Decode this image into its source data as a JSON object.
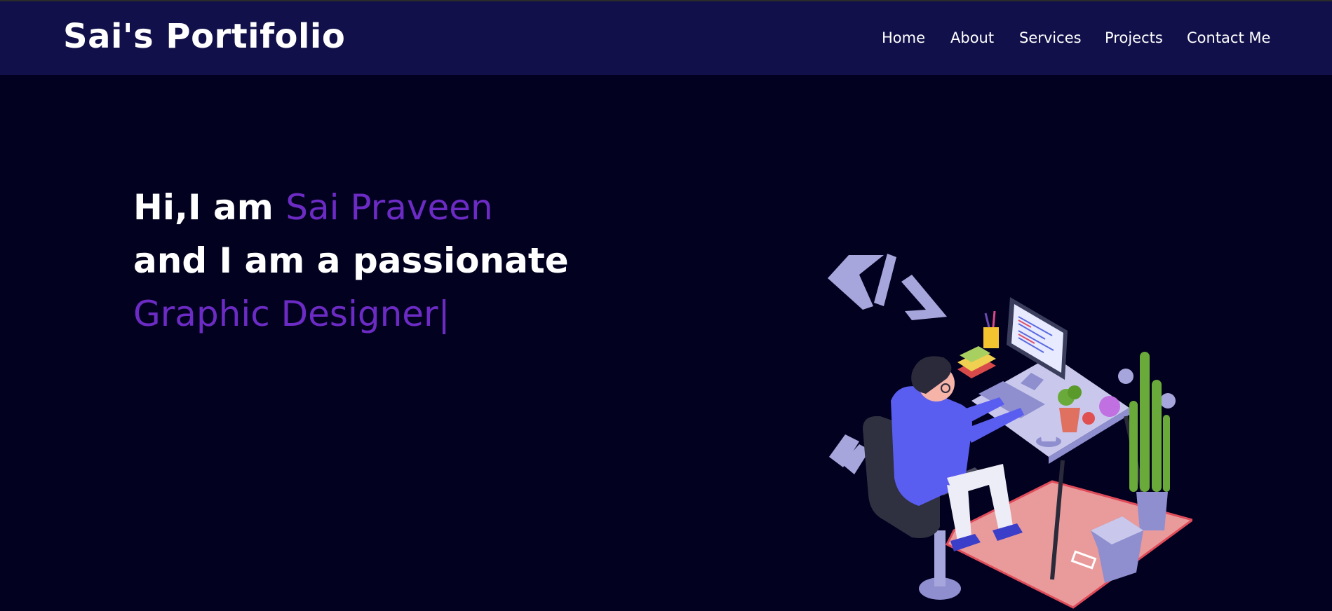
{
  "header": {
    "brand": "Sai's Portifolio",
    "nav": [
      "Home",
      "About",
      "Services",
      "Projects",
      "Contact Me"
    ]
  },
  "hero": {
    "greeting": "Hi,I am ",
    "name": "Sai Praveen",
    "line2": "and I am a passionate",
    "role": "Graphic Designer",
    "cursor": "|"
  },
  "colors": {
    "background": "#02011f",
    "navbar": "#11104a",
    "accent": "#6c2bc4",
    "text": "#ffffff"
  },
  "illustration": {
    "icon": "developer-at-desk-illustration"
  }
}
